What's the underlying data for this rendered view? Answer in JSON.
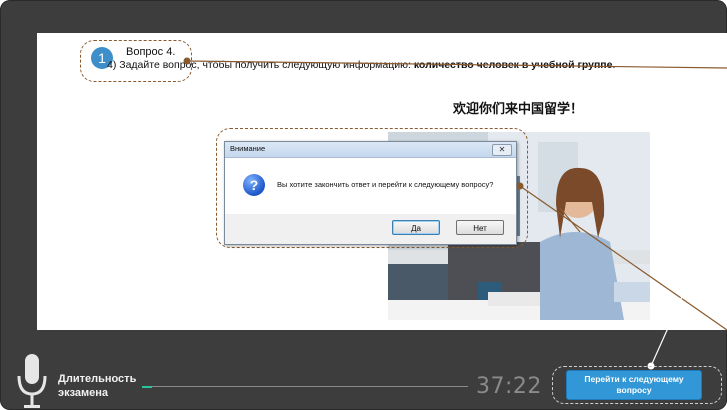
{
  "question": {
    "number": "1",
    "title": "Вопрос 4.",
    "prompt_prefix": "4)  Задайте вопрос, чтобы получить следующую информацию: ",
    "prompt_bold": "количество человек в учебной группе",
    "prompt_suffix": "."
  },
  "hanzi_caption": "欢迎你们来中国留学！",
  "dialog": {
    "title": "Внимание",
    "close_glyph": "✕",
    "icon": "question-icon",
    "message": "Вы хотите закончить ответ и перейти к следующему вопросу?",
    "yes_label": "Да",
    "no_label": "Нет"
  },
  "footer": {
    "duration_label_line1": "Длительность",
    "duration_label_line2": "экзамена",
    "timer": "37:22",
    "progress_fraction": 0.03,
    "next_button_label": "Перейти к следующему вопросу"
  },
  "colors": {
    "frame": "#3d3d3d",
    "accent_blue": "#3197d6",
    "progress": "#27c4a0",
    "callout_brown": "#8a5a2e"
  }
}
